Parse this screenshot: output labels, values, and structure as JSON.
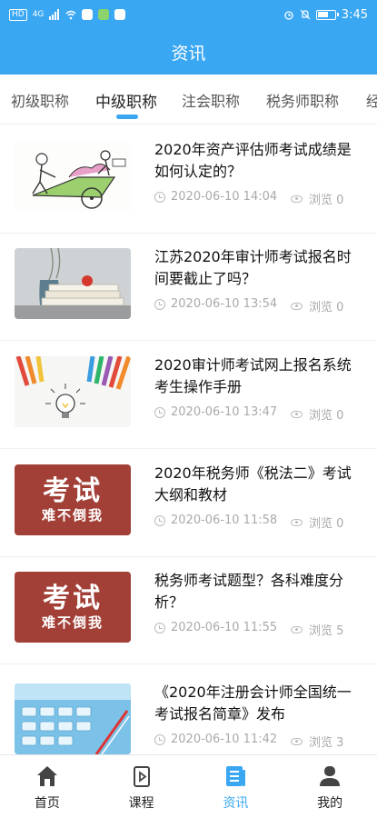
{
  "status_bar": {
    "time": "3:45",
    "hd": "HD",
    "signal": "4G"
  },
  "header": {
    "title": "资讯"
  },
  "tabs": [
    {
      "label": "初级职称"
    },
    {
      "label": "中级职称",
      "active": true
    },
    {
      "label": "注会职称"
    },
    {
      "label": "税务师职称"
    },
    {
      "label": "经"
    }
  ],
  "news": [
    {
      "title": "2020年资产评估师考试成绩是如何认定的？",
      "date": "2020-06-10 14:04",
      "views": "浏览 0",
      "thumb": "cartoon-cart"
    },
    {
      "title": "江苏2020年审计师考试报名时间要截止了吗？",
      "date": "2020-06-10 13:54",
      "views": "浏览 0",
      "thumb": "books-photo"
    },
    {
      "title": "2020审计师考试网上报名系统考生操作手册",
      "date": "2020-06-10 13:47",
      "views": "浏览 0",
      "thumb": "pencils-bulb"
    },
    {
      "title": "2020年税务师《税法二》考试大纲和教材",
      "date": "2020-06-10 11:58",
      "views": "浏览 0",
      "thumb": "exam-poster",
      "poster_big": "考试",
      "poster_small": "难不倒我"
    },
    {
      "title": "税务师考试题型？各科难度分析？",
      "date": "2020-06-10 11:55",
      "views": "浏览 5",
      "thumb": "exam-poster",
      "poster_big": "考试",
      "poster_small": "难不倒我"
    },
    {
      "title": "《2020年注册会计师全国统一考试报名简章》发布",
      "date": "2020-06-10 11:42",
      "views": "浏览 3",
      "thumb": "calculator-photo"
    }
  ],
  "bottom_nav": [
    {
      "label": "首页",
      "icon": "home-icon"
    },
    {
      "label": "课程",
      "icon": "course-icon"
    },
    {
      "label": "资讯",
      "icon": "news-icon",
      "active": true
    },
    {
      "label": "我的",
      "icon": "profile-icon"
    }
  ],
  "colors": {
    "primary": "#3aa7f3",
    "exam_poster": "#a23f36"
  }
}
